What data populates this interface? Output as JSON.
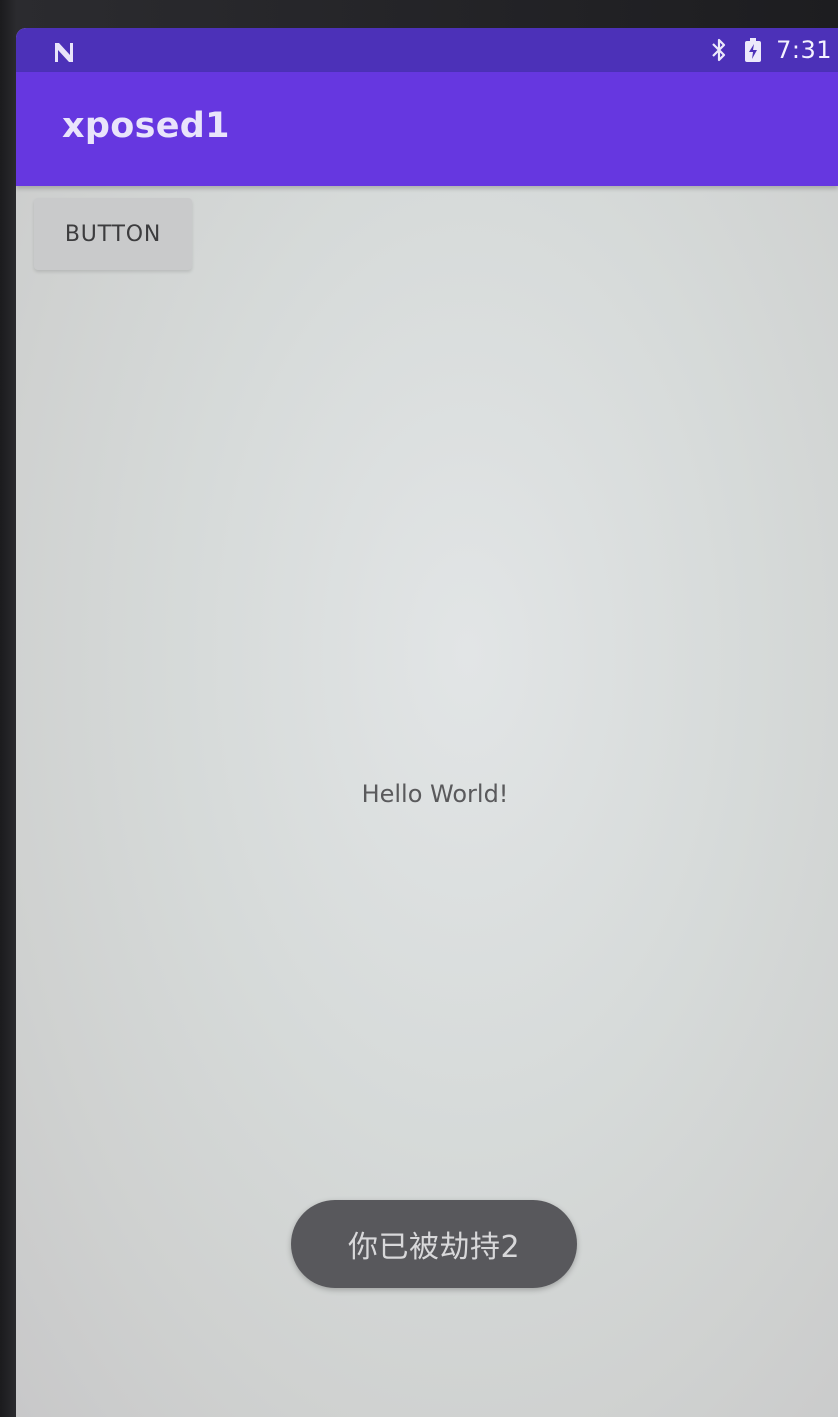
{
  "status_bar": {
    "time": "7:31",
    "icons": [
      "notification-n-icon",
      "bluetooth-icon",
      "battery-icon"
    ]
  },
  "app_bar": {
    "title": "xposed1"
  },
  "main": {
    "button_label": "BUTTON",
    "hello_text": "Hello World!"
  },
  "toast": {
    "message": "你已被劫持2"
  },
  "colors": {
    "status_bar": "#4c31b8",
    "app_bar": "#6637e0",
    "background": "#d6dad9",
    "button": "#c9cacb",
    "toast": "#58585c"
  }
}
